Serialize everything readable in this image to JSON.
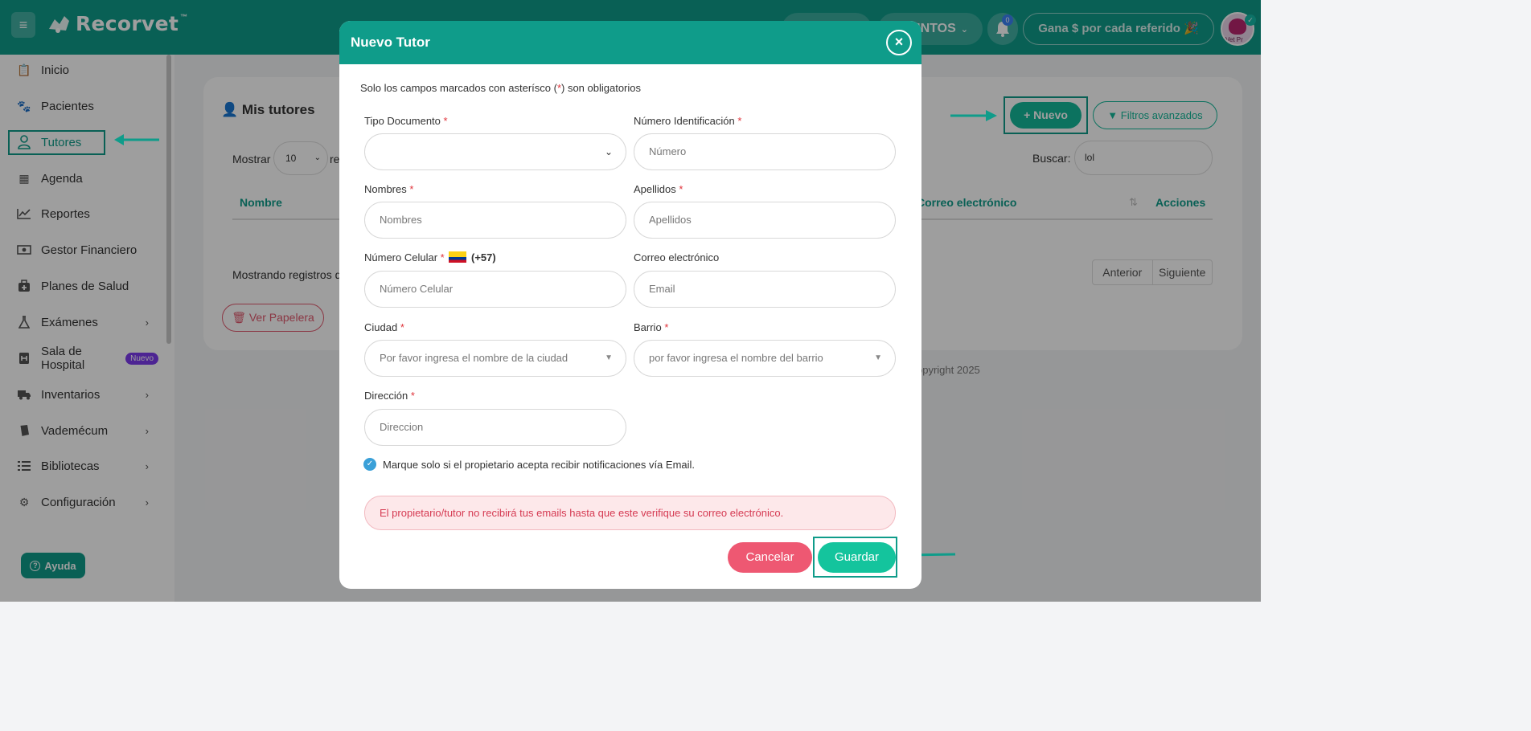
{
  "app": {
    "brand": "Recorvet",
    "tm": "™"
  },
  "topbar": {
    "puntos_label": "INTOS",
    "notif_count": "0",
    "referral_label": "Gana $ por cada referido",
    "referral_emoji": "🎉",
    "avatar_text": "Vet Pr"
  },
  "sidebar": {
    "items": [
      {
        "label": "Inicio",
        "icon": "clipboard-icon"
      },
      {
        "label": "Pacientes",
        "icon": "paw-icon"
      },
      {
        "label": "Tutores",
        "icon": "user-icon",
        "active": true
      },
      {
        "label": "Agenda",
        "icon": "calendar-icon"
      },
      {
        "label": "Reportes",
        "icon": "chart-line-icon"
      },
      {
        "label": "Gestor Financiero",
        "icon": "money-icon"
      },
      {
        "label": "Planes de Salud",
        "icon": "medkit-icon"
      },
      {
        "label": "Exámenes",
        "icon": "flask-icon",
        "submenu": true
      },
      {
        "label": "Sala de Hospital",
        "icon": "hospital-icon",
        "badge": "Nuevo"
      },
      {
        "label": "Inventarios",
        "icon": "truck-icon",
        "submenu": true
      },
      {
        "label": "Vademécum",
        "icon": "book-icon",
        "submenu": true
      },
      {
        "label": "Bibliotecas",
        "icon": "list-icon",
        "submenu": true
      },
      {
        "label": "Configuración",
        "icon": "cogs-icon",
        "submenu": true
      }
    ],
    "help_label": "Ayuda"
  },
  "page": {
    "title": "Mis tutores",
    "new_button": "Nuevo",
    "filters_button": "Filtros avanzados",
    "show_label": "Mostrar",
    "show_value": "10",
    "show_suffix": "re",
    "search_label": "Buscar:",
    "search_value": "lol",
    "columns": {
      "name": "Nombre",
      "email": "Correo electrónico",
      "actions": "Acciones"
    },
    "showing_text": "Mostrando registros d",
    "prev_label": "Anterior",
    "next_label": "Siguiente",
    "trash_button": "Ver Papelera",
    "copyright": "opyright 2025"
  },
  "modal": {
    "title": "Nuevo Tutor",
    "note_before": "Solo los campos marcados con asterísco (",
    "note_star": "*",
    "note_after": ") son obligatorios",
    "fields": {
      "doc_type": {
        "label": "Tipo Documento",
        "value": ""
      },
      "id_number": {
        "label": "Número Identificación",
        "placeholder": "Número"
      },
      "first_names": {
        "label": "Nombres",
        "placeholder": "Nombres"
      },
      "last_names": {
        "label": "Apellidos",
        "placeholder": "Apellidos"
      },
      "phone": {
        "label": "Número Celular",
        "prefix": "(+57)",
        "placeholder": "Número Celular"
      },
      "email": {
        "label": "Correo electrónico",
        "placeholder": "Email"
      },
      "city": {
        "label": "Ciudad",
        "placeholder": "Por favor ingresa el nombre de la ciudad"
      },
      "neighborhood": {
        "label": "Barrio",
        "placeholder": "por favor ingresa el nombre del barrio"
      },
      "address": {
        "label": "Dirección",
        "placeholder": "Direccion"
      }
    },
    "star": "*",
    "checkbox_label": "Marque solo si el propietario acepta recibir notificaciones vía Email.",
    "checkbox_checked": true,
    "alert_text": "El propietario/tutor no recibirá tus emails hasta que este verifique su correo electrónico.",
    "cancel_label": "Cancelar",
    "save_label": "Guardar"
  },
  "colors": {
    "primary": "#0f9c8a",
    "danger": "#ee5872",
    "save": "#14c49d",
    "badge": "#7c3aed"
  }
}
